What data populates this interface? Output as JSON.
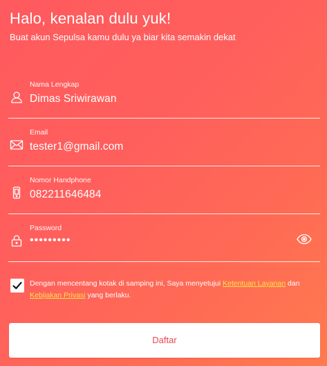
{
  "header": {
    "title": "Halo, kenalan dulu yuk!",
    "subtitle": "Buat akun Sepulsa kamu dulu ya biar kita semakin dekat"
  },
  "form": {
    "name": {
      "label": "Nama Lengkap",
      "value": "Dimas Sriwirawan",
      "icon": "user-icon"
    },
    "email": {
      "label": "Email",
      "value": "tester1@gmail.com",
      "icon": "envelope-icon"
    },
    "phone": {
      "label": "Nomor Handphone",
      "value": "082211646484",
      "icon": "phone-icon"
    },
    "password": {
      "label": "Password",
      "value": "•••••••••",
      "icon": "lock-icon",
      "toggle_icon": "eye-icon"
    }
  },
  "terms": {
    "checked": true,
    "text_before": "Dengan mencentang kotak di samping ini, Saya menyetujui ",
    "link1": "Ketentuan Layanan",
    "text_middle": " dan ",
    "link2": "Kebijakan Privasi",
    "text_after": " yang berlaku."
  },
  "submit": {
    "label": "Daftar"
  },
  "colors": {
    "background": "#ff5f5c",
    "link": "#ffe24a",
    "button_text": "#e8474f"
  }
}
